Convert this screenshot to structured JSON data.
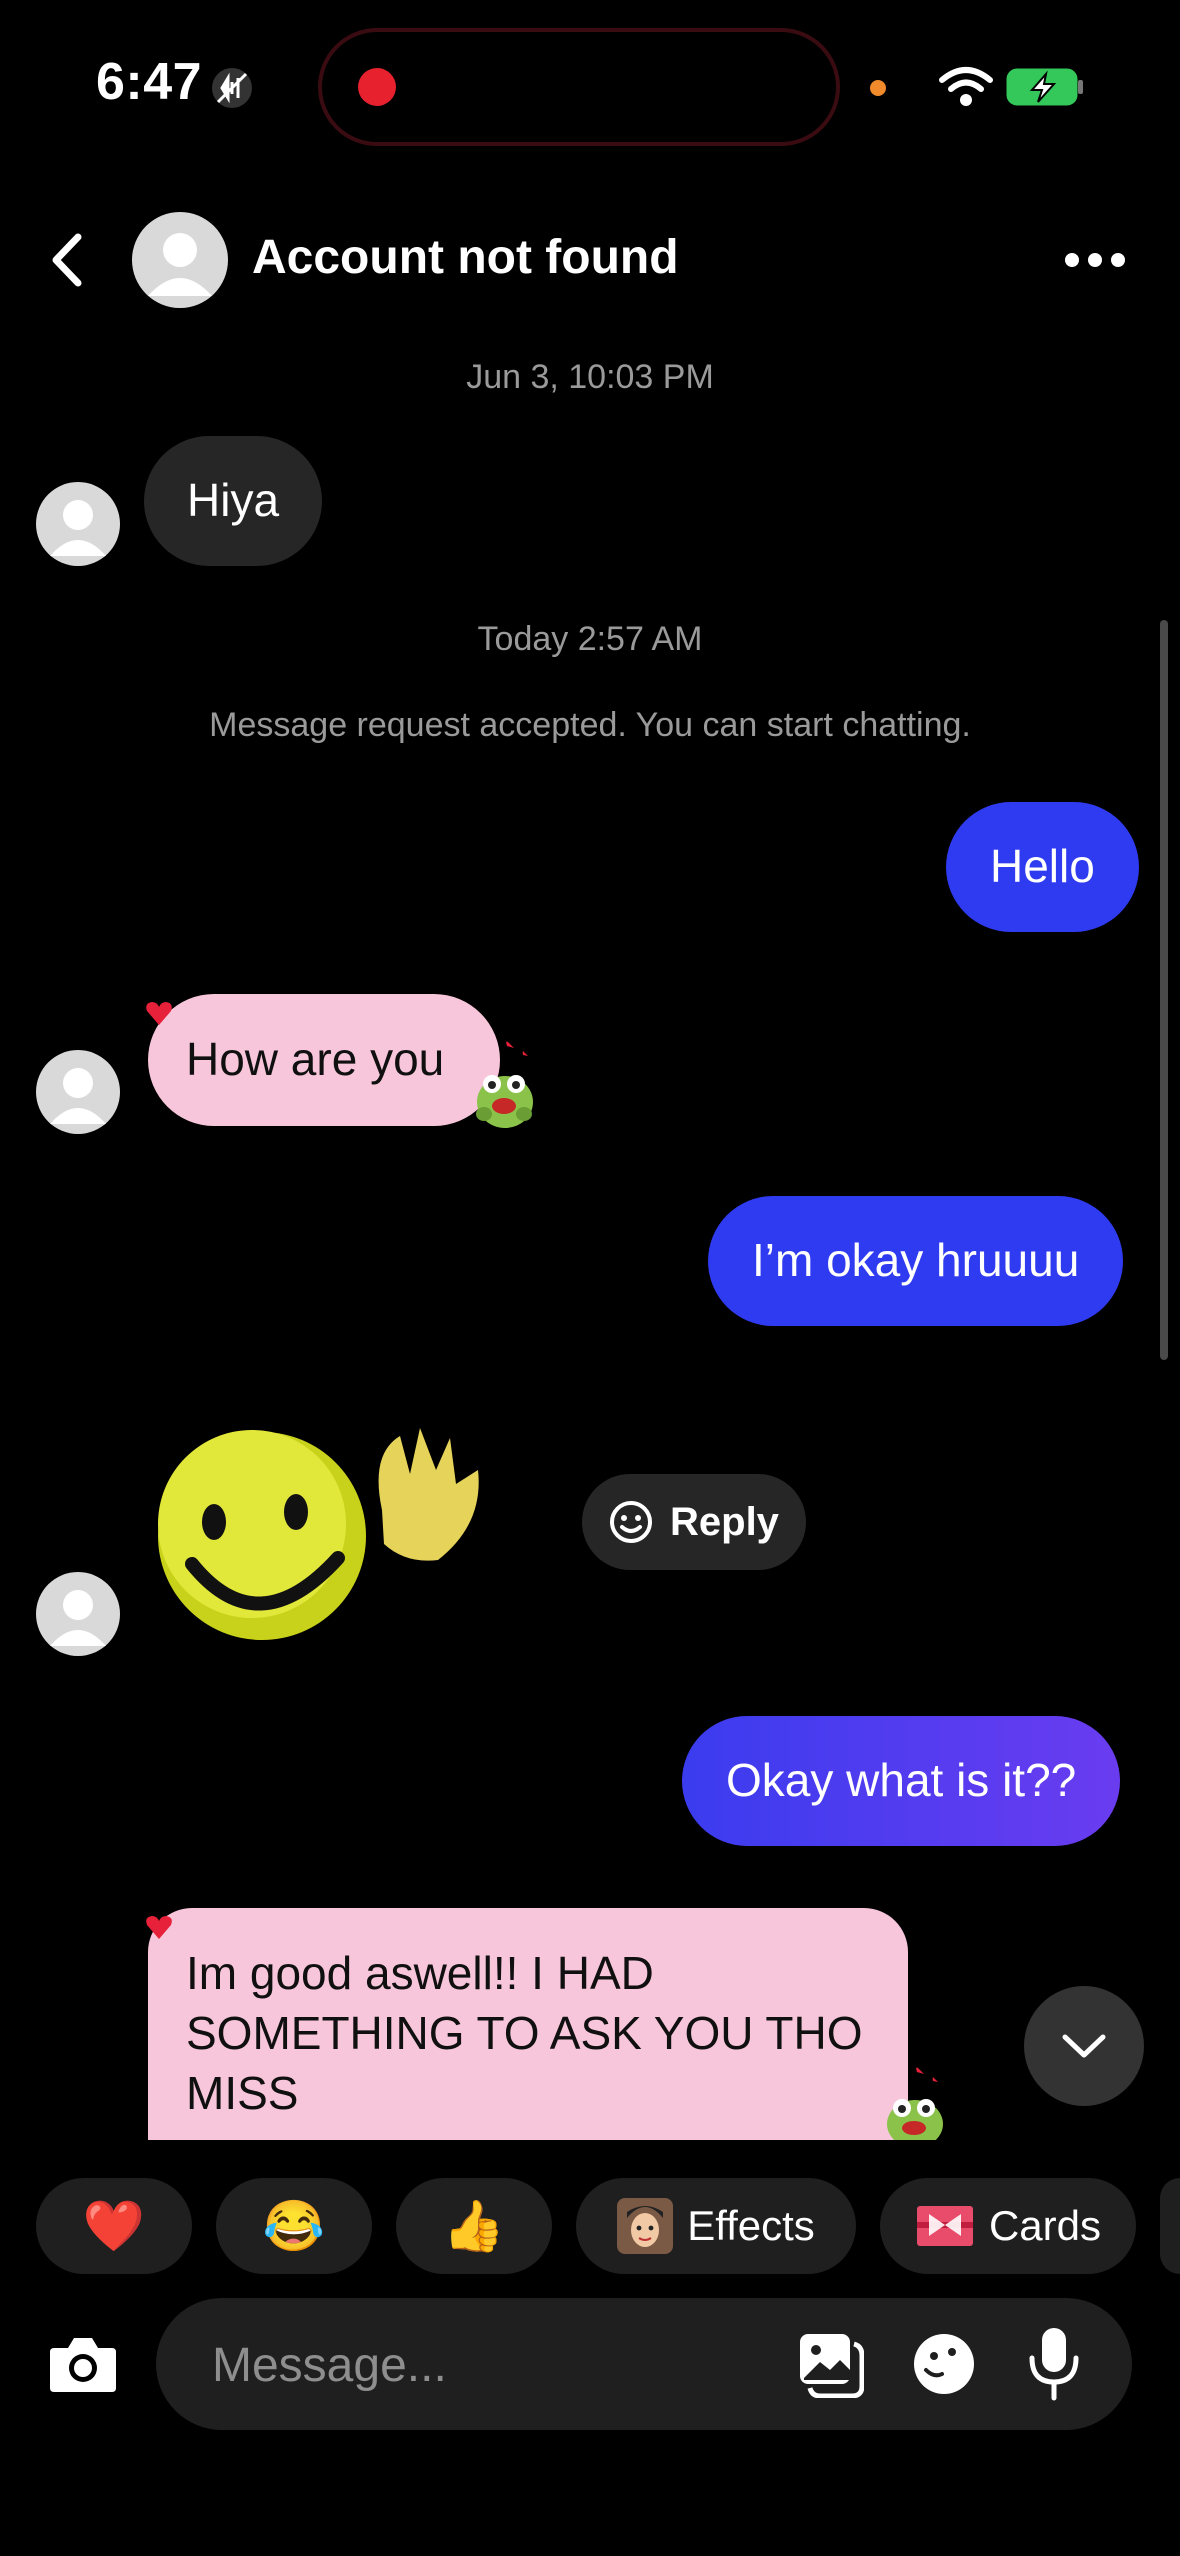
{
  "status": {
    "time": "6:47"
  },
  "header": {
    "title": "Account not found"
  },
  "thread": {
    "stamp_1": "Jun 3, 10:03 PM",
    "msg_hiya": "Hiya",
    "stamp_2": "Today 2:57 AM",
    "system_notice": "Message request accepted. You can start chatting.",
    "msg_hello": "Hello",
    "msg_how": "How are you",
    "msg_okay": "I’m okay hruuuu",
    "reply_label": "Reply",
    "msg_what": "Okay what is it??",
    "msg_good_1": "Im good aswell!! I HAD",
    "msg_good_2": "SOMETHING TO ASK YOU THO",
    "msg_good_3": "MISS"
  },
  "quick_bar": {
    "heart": "❤️",
    "laugh": "😂",
    "thumbs": "👍",
    "effects": "Effects",
    "cards": "Cards"
  },
  "composer": {
    "placeholder": "Message..."
  },
  "colors": {
    "outgoing_blue": "#2f3bf0",
    "outgoing_purple": "#5a3cf0",
    "incoming_pink": "#f7c6da",
    "incoming_dark": "#262626"
  },
  "icons": [
    "back-icon",
    "avatar-placeholder-icon",
    "more-icon",
    "smiley-reply-icon",
    "chevron-down-icon",
    "camera-icon",
    "gallery-icon",
    "sticker-icon",
    "microphone-icon",
    "wifi-icon",
    "battery-charging-icon"
  ]
}
